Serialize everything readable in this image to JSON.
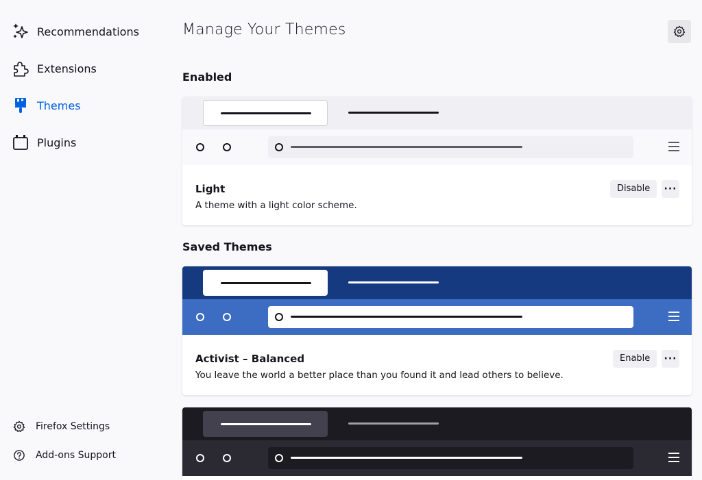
{
  "sidebar": {
    "items": [
      {
        "label": "Recommendations",
        "icon": "sparkle-icon"
      },
      {
        "label": "Extensions",
        "icon": "puzzle-icon"
      },
      {
        "label": "Themes",
        "icon": "paintbrush-icon",
        "active": true
      },
      {
        "label": "Plugins",
        "icon": "plugin-icon"
      }
    ],
    "footer": [
      {
        "label": "Firefox Settings",
        "icon": "gear-icon"
      },
      {
        "label": "Add-ons Support",
        "icon": "help-icon"
      }
    ]
  },
  "main": {
    "title": "Manage Your Themes",
    "enabled_heading": "Enabled",
    "saved_heading": "Saved Themes"
  },
  "themes": {
    "light": {
      "name": "Light",
      "description": "A theme with a light color scheme.",
      "action": "Disable",
      "more": "···",
      "colors": {
        "tabs": "#f0f0f4",
        "toolbar": "#f9f9fb",
        "urlbar": "#f0f0f4",
        "ink": "#15141a"
      }
    },
    "activist": {
      "name": "Activist – Balanced",
      "description": "You leave the world a better place than you found it and lead others to believe.",
      "action": "Enable",
      "more": "···",
      "colors": {
        "tabs": "#163a80",
        "toolbar": "#3d6dc2",
        "urlbar": "#ffffff",
        "ink": "#ffffff"
      }
    },
    "dark": {
      "colors": {
        "tabs": "#1c1b22",
        "toolbar": "#2b2a33",
        "urlbar": "#1c1b22",
        "ink": "#ffffff"
      }
    }
  },
  "colors": {
    "accent": "#0061e0",
    "text": "#15141a",
    "button_bg": "#f0f0f4"
  }
}
